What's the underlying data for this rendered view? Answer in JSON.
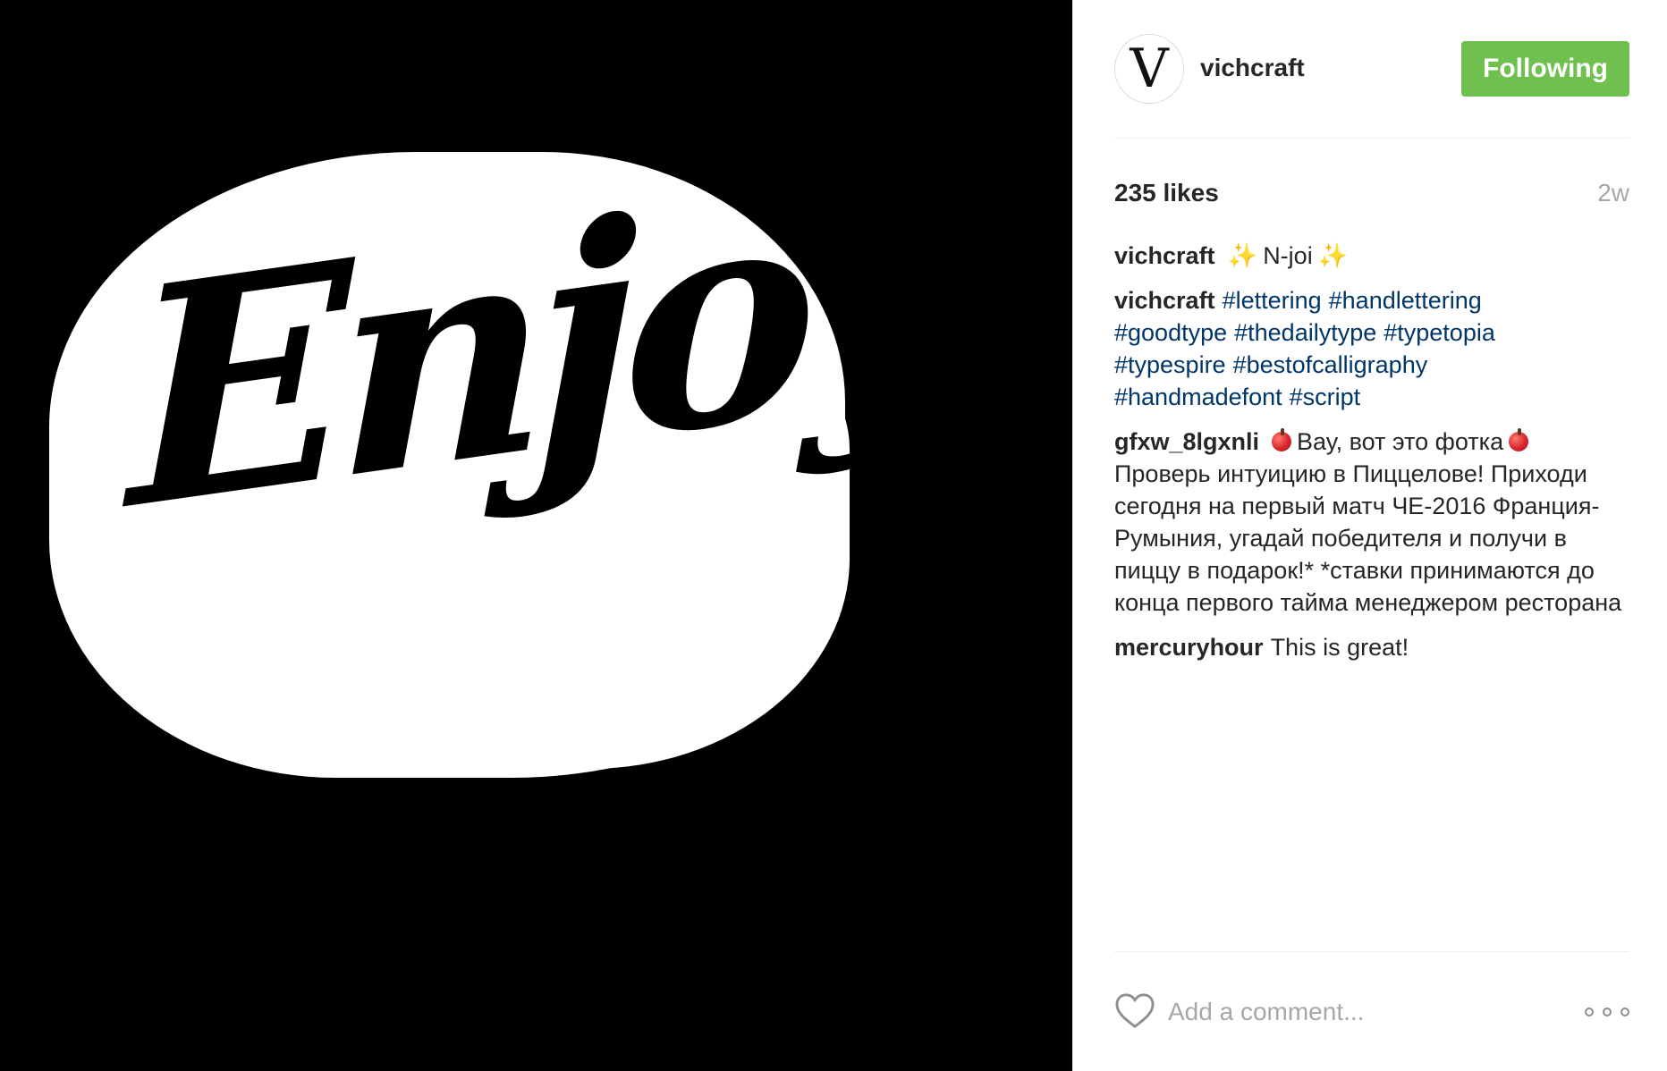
{
  "post": {
    "image": {
      "icon": "enjoy-lettering-artwork",
      "artwork_text": "Enjoy",
      "background_color": "#000000",
      "letter_color": "#000000",
      "outline_color": "#ffffff"
    },
    "header": {
      "avatar_letter": "V",
      "username": "vichcraft",
      "follow_button_label": "Following",
      "follow_button_color": "#70c050"
    },
    "meta": {
      "likes": "235 likes",
      "timestamp": "2w"
    },
    "caption": {
      "user": "vichcraft",
      "sparkle_left": "✨",
      "text": "N-joi",
      "sparkle_right": "✨"
    },
    "hashtag_comment": {
      "user": "vichcraft",
      "tags": [
        "#lettering",
        "#handlettering",
        "#goodtype",
        "#thedailytype",
        "#typetopia",
        "#typespire",
        "#bestofcalligraphy",
        "#handmadefont",
        "#script"
      ]
    },
    "comments": [
      {
        "user": "gfxw_8lgxnli",
        "text_before": "Вау, вот это фотка",
        "text_after": "Проверь интуицию в Пиццелове! Приходи сегодня на первый матч ЧЕ-2016 Франция-Румыния, угадай победителя и получи в пиццу в подарок!* *ставки принимаются до конца первого тайма менеджером ресторана"
      },
      {
        "user": "mercuryhour",
        "text": "This is great!"
      }
    ],
    "comment_box": {
      "placeholder": "Add a comment...",
      "heart_icon": "heart-icon",
      "more_icon": "more-options-icon"
    },
    "colors": {
      "hashtag": "#003569",
      "secondary_text": "#a5a7aa",
      "primary_text": "#262626"
    }
  }
}
